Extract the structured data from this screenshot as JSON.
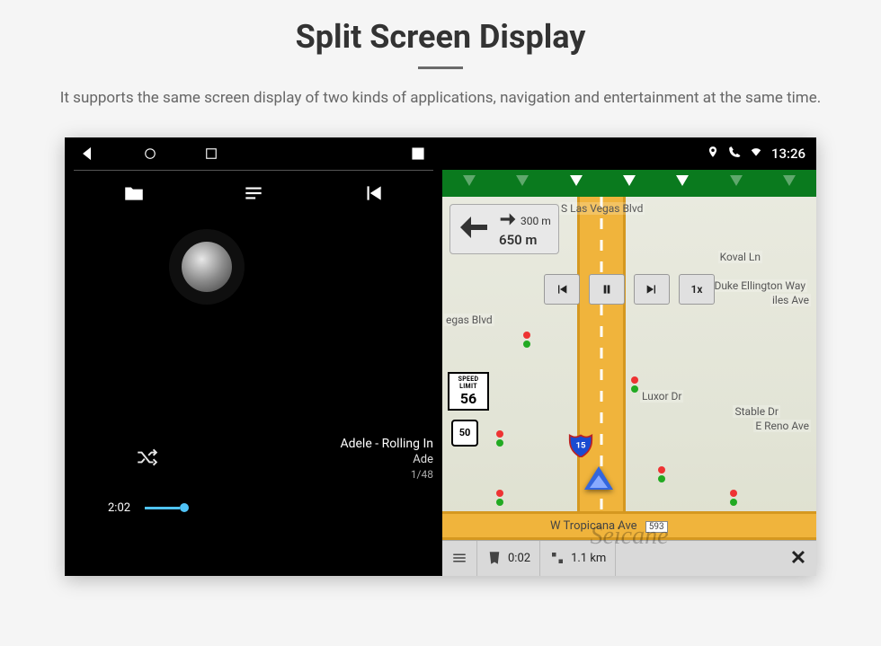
{
  "header": {
    "title": "Split Screen Display",
    "subtitle": "It supports the same screen display of two kinds of applications, navigation and entertainment at the same time."
  },
  "status": {
    "time": "13:26"
  },
  "player": {
    "track_title": "Adele - Rolling In",
    "track_artist": "Ade",
    "track_index": "1/48",
    "elapsed": "2:02"
  },
  "map": {
    "street_top": "S Las Vegas Blvd",
    "street_right_1": "Duke Ellington Way",
    "street_right_2": "E Reno Ave",
    "street_left": "egas Blvd",
    "poi_luxor": "Luxor Dr",
    "poi_stable": "Stable Dr",
    "poi_koval": "Koval Ln",
    "poi_iles": "iles Ave",
    "turn_primary_dist": "650 m",
    "turn_secondary_dist": "300 m",
    "speed_limit_label": "SPEED LIMIT",
    "speed_limit_value": "56",
    "route_shield": "50",
    "interstate": "15",
    "playback_speed": "1x",
    "bottom_street": "W Tropicana Ave",
    "bottom_street_num": "593",
    "footer_time": "0:02",
    "footer_dist": "1.1 km"
  },
  "watermark": "Seicane"
}
